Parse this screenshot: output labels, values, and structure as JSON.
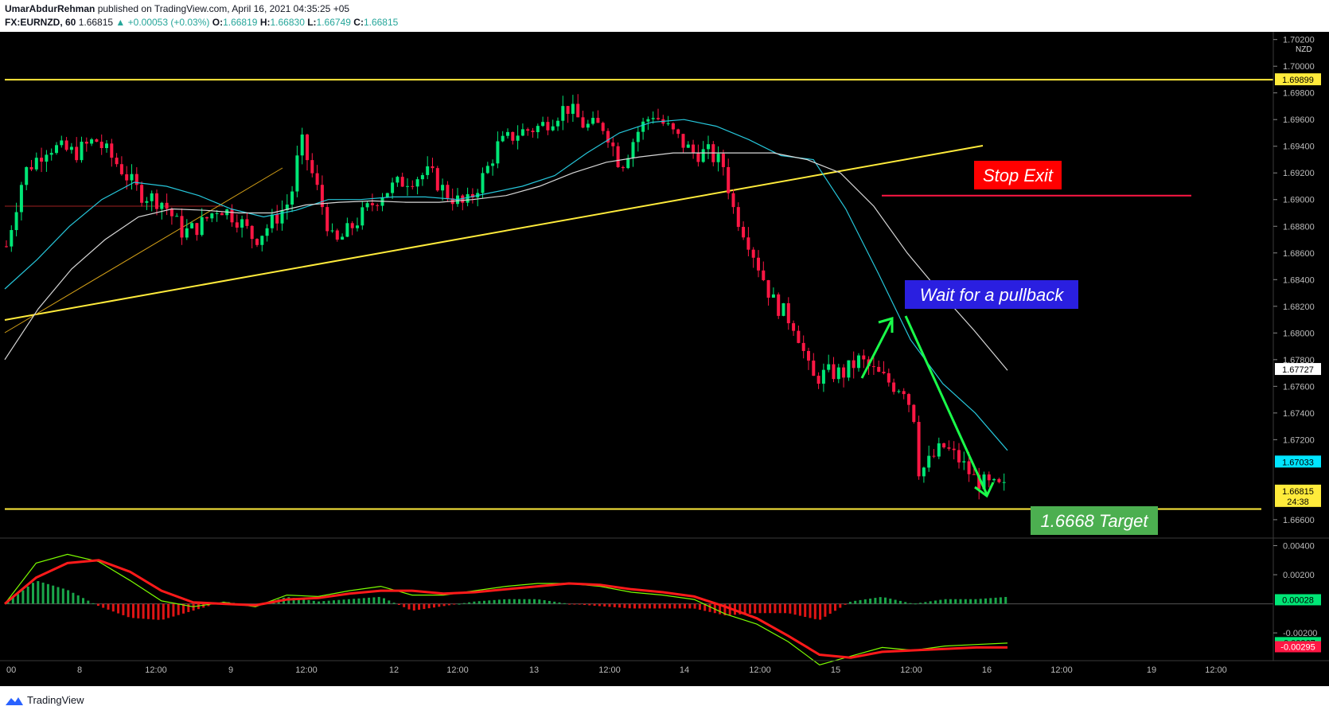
{
  "header": {
    "author": "UmarAbdurRehman",
    "published": "published on TradingView.com, April 16, 2021 04:35:25 +05",
    "symbol": "FX:EURNZD, 60",
    "last": "1.66815",
    "change": "▲ +0.00053 (+0.03%)",
    "o_label": "O:",
    "o_value": "1.66819",
    "h_label": "H:",
    "h_value": "1.66830",
    "l_label": "L:",
    "l_value": "1.66749",
    "c_label": "C:",
    "c_value": "1.66815"
  },
  "footer": {
    "brand": "TradingView"
  },
  "colors": {
    "up": "#00e676",
    "down": "#ff1744",
    "ema_fast": "#26c6da",
    "ema_slow": "#d8d8d8",
    "yellow": "#ffeb3b",
    "macd": "#7cfc00",
    "signal": "#ff1a1a",
    "bg": "#000000"
  },
  "chart_data": [
    {
      "type": "candlestick",
      "currency_label": "NZD",
      "ylim": [
        1.6648,
        1.7021
      ],
      "y_ticks": [
        "1.70200",
        "1.70000",
        "1.69800",
        "1.69600",
        "1.69400",
        "1.69200",
        "1.69000",
        "1.68800",
        "1.68600",
        "1.68400",
        "1.68200",
        "1.68000",
        "1.67800",
        "1.67600",
        "1.67400",
        "1.67200",
        "1.66600"
      ],
      "x_labels": [
        "00",
        "8",
        "12:00",
        "9",
        "12:00",
        "12",
        "12:00",
        "13",
        "12:00",
        "14",
        "12:00",
        "15",
        "12:00",
        "16",
        "12:00",
        "19",
        "12:00"
      ],
      "price_labels": [
        {
          "value": 1.69899,
          "text": "1.69899",
          "style": "yellow"
        },
        {
          "value": 1.67727,
          "text": "1.67727",
          "style": "white"
        },
        {
          "value": 1.67033,
          "text": "1.67033",
          "style": "cyan"
        },
        {
          "value": 1.66815,
          "text": "1.66815",
          "subtext": "24:38",
          "style": "yellow"
        }
      ],
      "annotations": [
        {
          "text": "Stop Exit",
          "bg": "#ff0000",
          "fg": "#ffffff"
        },
        {
          "text": "Wait for a pullback",
          "bg": "#2a1fe0",
          "fg": "#ffffff"
        },
        {
          "text": "1.6668 Target",
          "bg": "#4caf50",
          "fg": "#ffffff"
        }
      ],
      "levels": {
        "resistance": 1.69899,
        "target": 1.6668,
        "stop": 1.6903
      },
      "series": [
        {
          "name": "EMA fast",
          "values": [
            1.6833,
            1.6855,
            1.688,
            1.69,
            1.6913,
            1.691,
            1.6903,
            1.6893,
            1.6887,
            1.6892,
            1.69,
            1.69,
            1.6902,
            1.6902,
            1.69,
            1.6905,
            1.691,
            1.6918,
            1.6935,
            1.695,
            1.6958,
            1.696,
            1.6955,
            1.6945,
            1.6933,
            1.693,
            1.6893,
            1.6845,
            1.6795,
            1.6762,
            1.674,
            1.6712
          ]
        },
        {
          "name": "EMA slow",
          "values": [
            1.678,
            1.6818,
            1.6848,
            1.687,
            1.6887,
            1.6893,
            1.6892,
            1.689,
            1.689,
            1.6896,
            1.6898,
            1.6899,
            1.6898,
            1.6898,
            1.69,
            1.6903,
            1.691,
            1.692,
            1.6928,
            1.6932,
            1.6935,
            1.6935,
            1.6935,
            1.6935,
            1.693,
            1.692,
            1.6895,
            1.686,
            1.683,
            1.6802,
            1.6772
          ]
        },
        {
          "name": "MACD",
          "values": [
            0.0,
            0.0028,
            0.0034,
            0.0029,
            0.0016,
            0.0002,
            -0.0002,
            0.0001,
            -0.0002,
            0.0006,
            0.0005,
            0.0009,
            0.0012,
            0.0006,
            0.0006,
            0.0009,
            0.0012,
            0.0014,
            0.0014,
            0.0012,
            0.0008,
            0.0006,
            0.0003,
            -0.0007,
            -0.0014,
            -0.0026,
            -0.0042,
            -0.0036,
            -0.003,
            -0.0032,
            -0.0029,
            -0.0028,
            -0.0027
          ]
        },
        {
          "name": "Signal",
          "values": [
            0.0,
            0.0018,
            0.0028,
            0.003,
            0.0022,
            0.0009,
            0.0001,
            0.0,
            -0.0001,
            0.0003,
            0.0004,
            0.0007,
            0.0009,
            0.0009,
            0.0007,
            0.0008,
            0.001,
            0.0012,
            0.0014,
            0.0013,
            0.001,
            0.0008,
            0.0005,
            -0.0002,
            -0.001,
            -0.0022,
            -0.0035,
            -0.0037,
            -0.0033,
            -0.0032,
            -0.0031,
            -0.003,
            -0.003
          ]
        }
      ],
      "indicator": {
        "ylim": [
          -0.0038,
          0.0043
        ],
        "y_ticks": [
          "0.00400",
          "0.00200",
          "-0.00200"
        ],
        "price_labels": [
          {
            "value": 0.00028,
            "text": "0.00028",
            "style": "green"
          },
          {
            "value": -0.00267,
            "text": "-0.00267",
            "style": "green"
          },
          {
            "value": -0.00295,
            "text": "-0.00295",
            "style": "red"
          }
        ]
      }
    }
  ]
}
